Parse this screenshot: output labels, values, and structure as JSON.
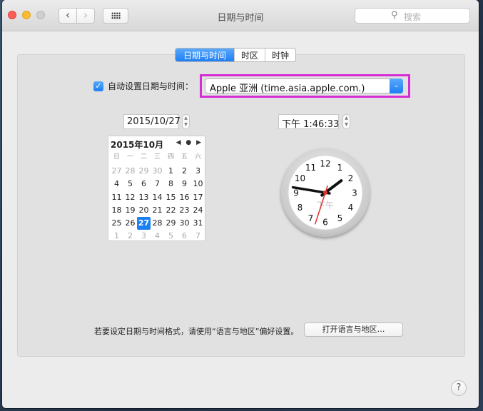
{
  "window": {
    "title": "日期与时间"
  },
  "toolbar": {
    "back_icon": "‹",
    "forward_icon": "›",
    "search_placeholder": "搜索",
    "search_icon": "⚲"
  },
  "tabs": [
    {
      "label": "日期与时间",
      "active": true
    },
    {
      "label": "时区",
      "active": false
    },
    {
      "label": "时钟",
      "active": false
    }
  ],
  "auto": {
    "checked": true,
    "check_glyph": "✓",
    "label": "自动设置日期与时间：",
    "server": "Apple 亚洲 (time.asia.apple.com.)",
    "arrow_glyph": "⌄"
  },
  "date_value": "2015/10/27",
  "time_value": "下午  1:46:33",
  "stepper_glyph": {
    "up": "▲",
    "down": "▼"
  },
  "calendar": {
    "month_label": "2015年10月",
    "nav": "◀ ● ▶",
    "weekdays": [
      "日",
      "一",
      "二",
      "三",
      "四",
      "五",
      "六"
    ],
    "days": [
      [
        "27",
        "28",
        "29",
        "30",
        "1",
        "2",
        "3"
      ],
      [
        "4",
        "5",
        "6",
        "7",
        "8",
        "9",
        "10"
      ],
      [
        "11",
        "12",
        "13",
        "14",
        "15",
        "16",
        "17"
      ],
      [
        "18",
        "19",
        "20",
        "21",
        "22",
        "23",
        "24"
      ],
      [
        "25",
        "26",
        "27",
        "28",
        "29",
        "30",
        "31"
      ],
      [
        "1",
        "2",
        "3",
        "4",
        "5",
        "6",
        "7"
      ]
    ],
    "selected_day": "27"
  },
  "clock": {
    "numbers": [
      "12",
      "1",
      "2",
      "3",
      "4",
      "5",
      "6",
      "7",
      "8",
      "9",
      "10",
      "11"
    ],
    "ampm": "下午",
    "hours": 1,
    "minutes": 46,
    "seconds": 33
  },
  "footer": {
    "text": "若要设定日期与时间格式，请使用“语言与地区”偏好设置。",
    "button": "打开语言与地区…"
  },
  "help_label": "?",
  "colors": {
    "accent": "#1d7ef3",
    "highlight_box": "#d62cd6",
    "second_hand": "#e0322f"
  }
}
